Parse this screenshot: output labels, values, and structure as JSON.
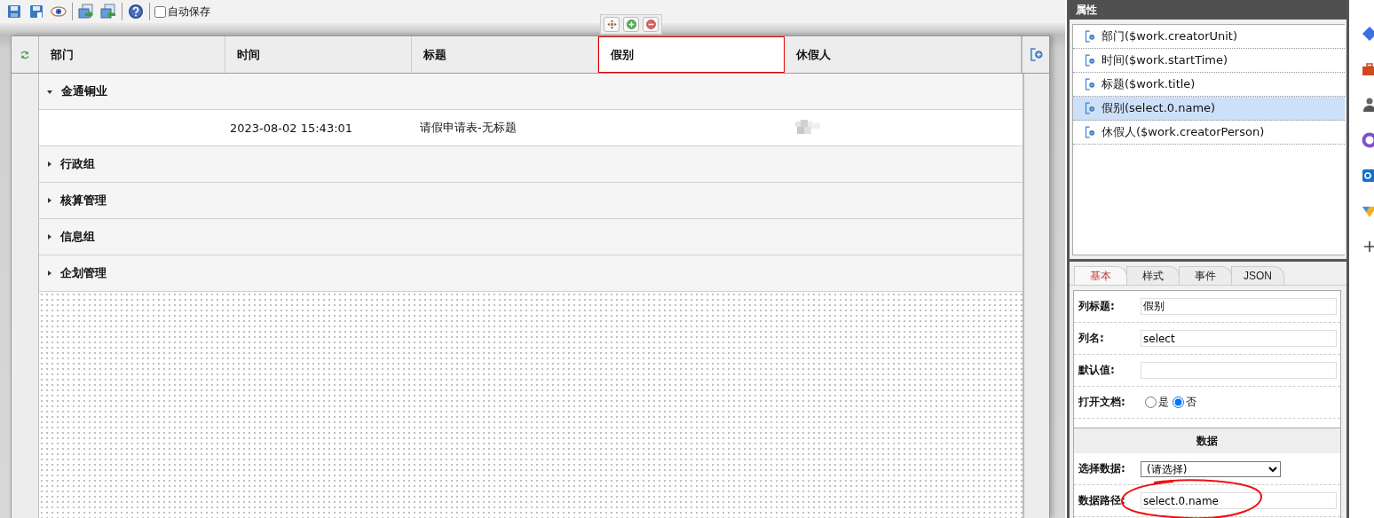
{
  "toolbar": {
    "autosave": {
      "label": "自动保存",
      "checked": false
    }
  },
  "table": {
    "columns": [
      {
        "label": "部门",
        "selected": false
      },
      {
        "label": "时间",
        "selected": false
      },
      {
        "label": "标题",
        "selected": false
      },
      {
        "label": "假别",
        "selected": true
      },
      {
        "label": "休假人",
        "selected": false
      }
    ],
    "groups": [
      {
        "name": "金通铜业",
        "expanded": true,
        "rows": [
          {
            "time": "2023-08-02 15:43:01",
            "title": "请假申请表-无标题",
            "applicant_redacted": true
          }
        ]
      },
      {
        "name": "行政组",
        "expanded": false
      },
      {
        "name": "核算管理",
        "expanded": false
      },
      {
        "name": "信息组",
        "expanded": false
      },
      {
        "name": "企划管理",
        "expanded": false
      }
    ]
  },
  "properties": {
    "title": "属性",
    "items": [
      {
        "label": "部门($work.creatorUnit)",
        "selected": false
      },
      {
        "label": "时间($work.startTime)",
        "selected": false
      },
      {
        "label": "标题($work.title)",
        "selected": false
      },
      {
        "label": "假别(select.0.name)",
        "selected": true
      },
      {
        "label": "休假人($work.creatorPerson)",
        "selected": false
      }
    ],
    "tabs": [
      {
        "label": "基本",
        "selected": true
      },
      {
        "label": "样式",
        "selected": false
      },
      {
        "label": "事件",
        "selected": false
      },
      {
        "label": "JSON",
        "selected": false
      }
    ],
    "fields": [
      {
        "kind": "text",
        "label": "列标题:",
        "value": "假别"
      },
      {
        "kind": "text",
        "label": "列名:",
        "value": "select"
      },
      {
        "kind": "text",
        "label": "默认值:"
      },
      {
        "kind": "radio",
        "label": "打开文档:",
        "options": [
          {
            "label": "是",
            "selected": false
          },
          {
            "label": "否",
            "selected": true
          }
        ]
      },
      {
        "kind": "section",
        "label": "数据"
      },
      {
        "kind": "select",
        "label": "选择数据:",
        "value": "(请选择)"
      },
      {
        "kind": "text",
        "label": "数据路径:",
        "value": "select.0.name",
        "circled": true
      }
    ]
  }
}
